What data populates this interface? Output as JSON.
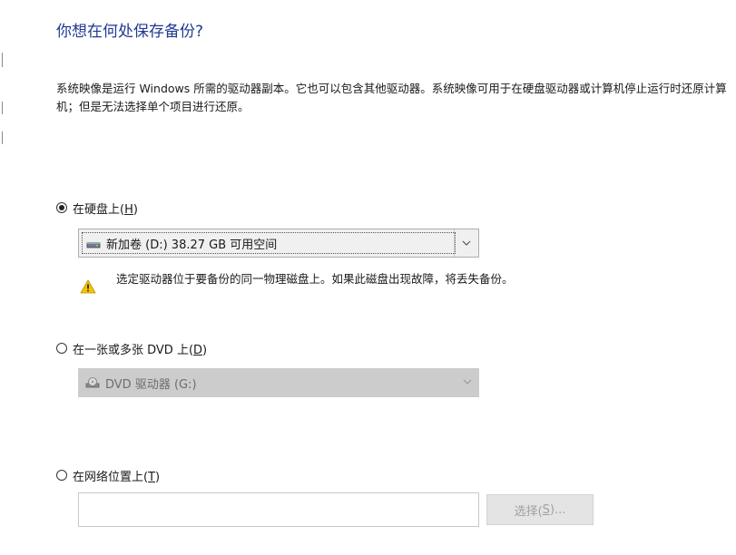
{
  "heading": "你想在何处保存备份?",
  "description": "系统映像是运行 Windows 所需的驱动器副本。它也可以包含其他驱动器。系统映像可用于在硬盘驱动器或计算机停止运行时还原计算机；但是无法选择单个项目进行还原。",
  "hard_disk": {
    "label": "在硬盘上(",
    "accel": "H",
    "label_end": ")",
    "selected": true,
    "drive_value": "新加卷 (D:)  38.27 GB 可用空间",
    "warning": "选定驱动器位于要备份的同一物理磁盘上。如果此磁盘出现故障，将丢失备份。"
  },
  "dvd": {
    "label": "在一张或多张 DVD 上(",
    "accel": "D",
    "label_end": ")",
    "selected": false,
    "drive_value": "DVD 驱动器 (G:)"
  },
  "network": {
    "label": "在网络位置上(",
    "accel": "T",
    "label_end": ")",
    "selected": false,
    "path_value": "",
    "browse_label": "选择(",
    "browse_accel": "S",
    "browse_end": ")..."
  },
  "icons": {
    "warning": "warning-icon",
    "hard_drive": "hard-drive-icon",
    "dvd_drive": "dvd-drive-icon",
    "dropdown": "chevron-down-icon"
  },
  "colors": {
    "heading": "#1f3a93",
    "warning_fill": "#f5c400"
  }
}
